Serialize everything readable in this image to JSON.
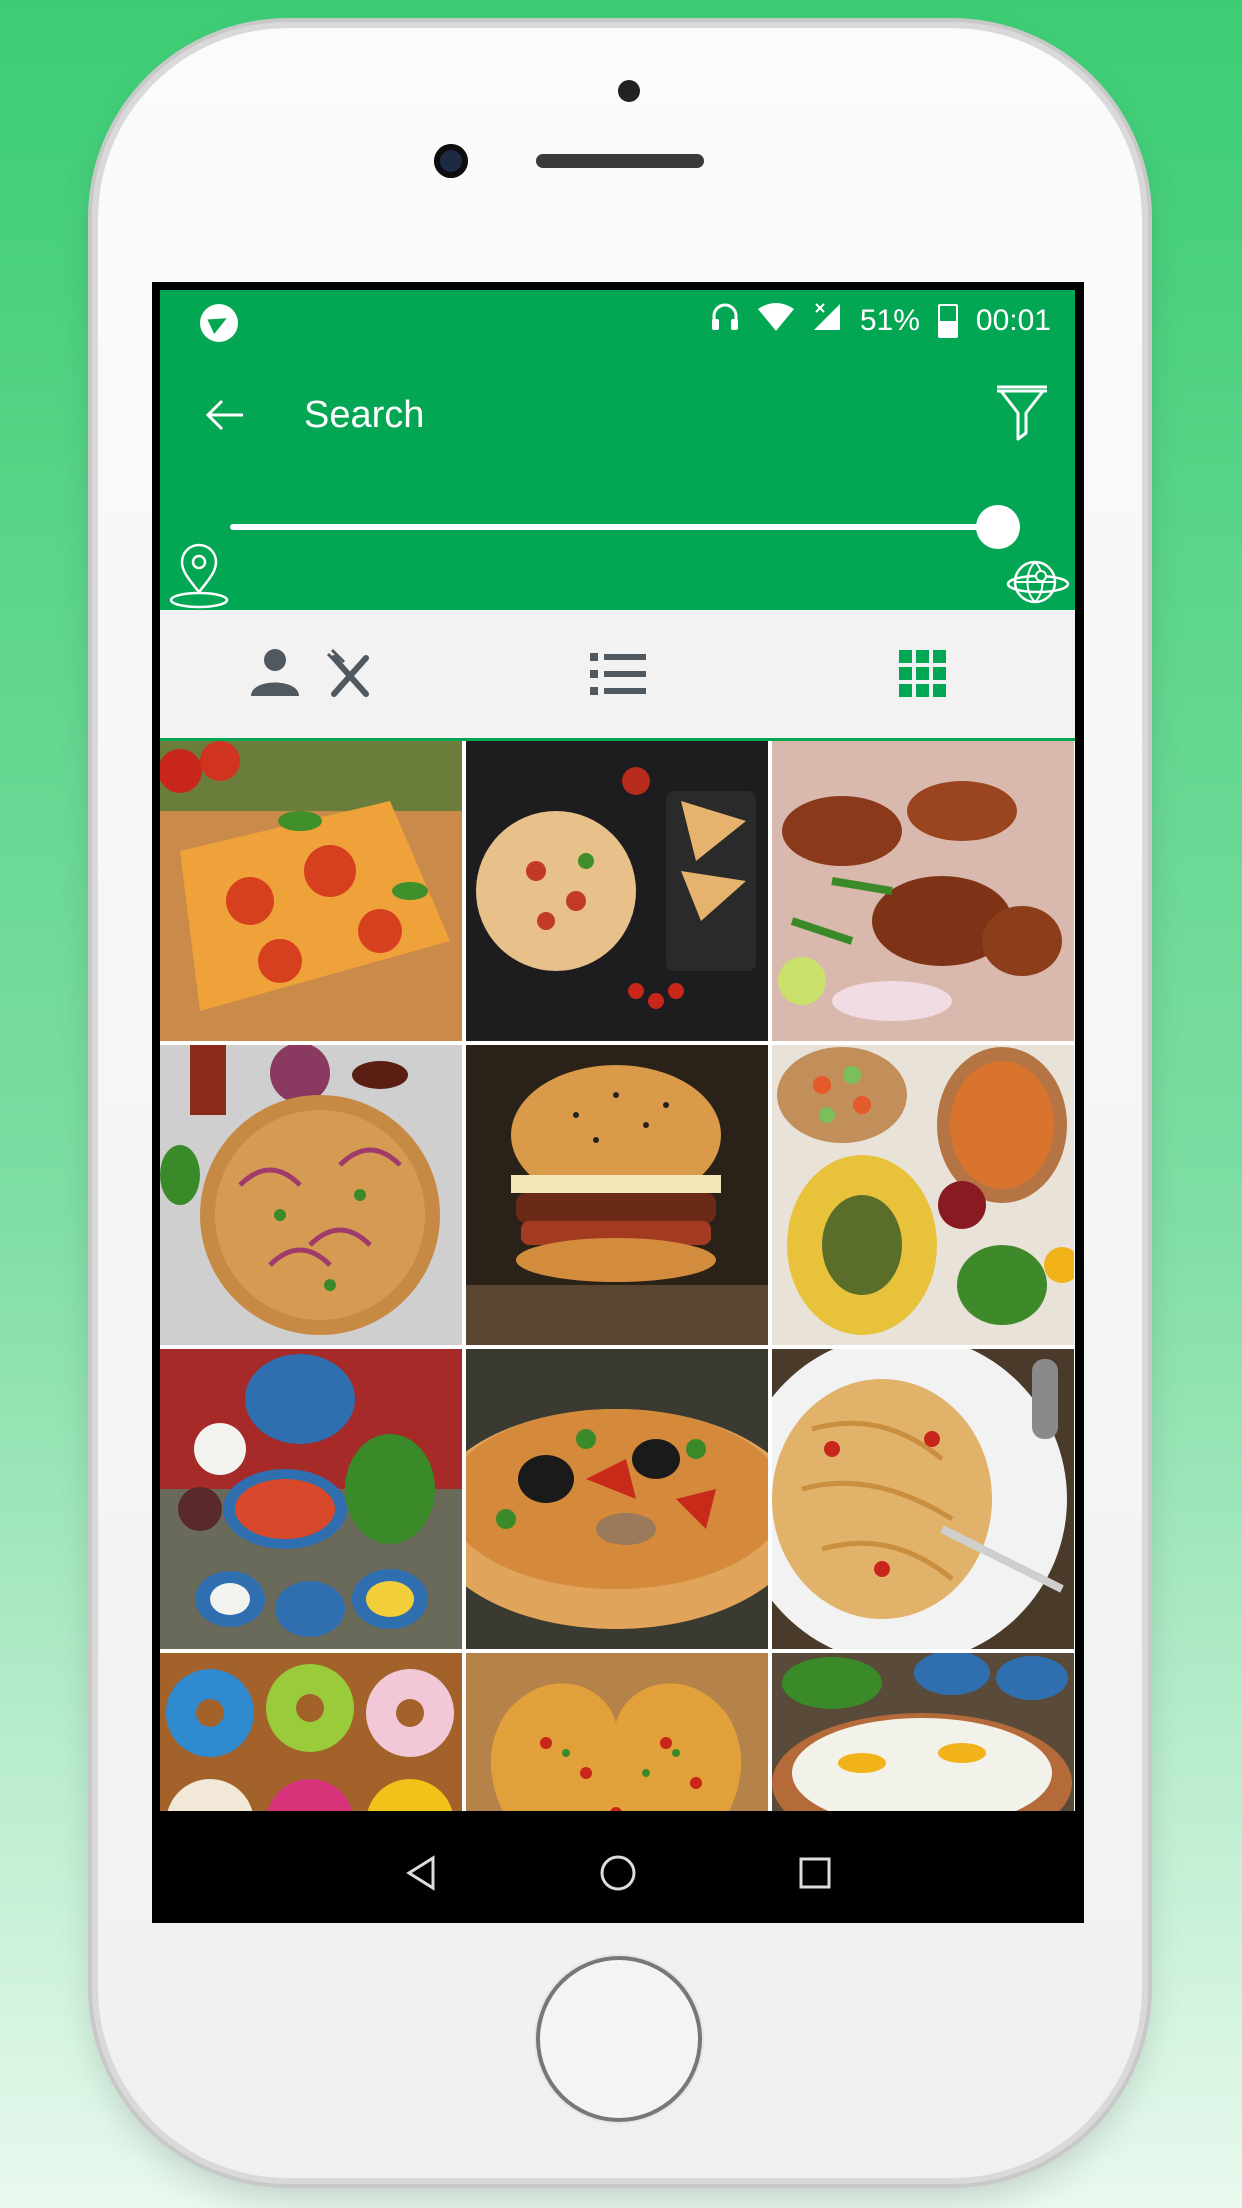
{
  "status_bar": {
    "battery": "51%",
    "time": "00:01"
  },
  "toolbar": {
    "title": "Search"
  },
  "distance_slider": {
    "value_fraction": 1.0
  },
  "view_tabs": [
    {
      "name": "people-and-restaurants",
      "selected": false
    },
    {
      "name": "list-view",
      "selected": false
    },
    {
      "name": "grid-view",
      "selected": true
    }
  ],
  "colors": {
    "accent": "#03a653",
    "tab_active": "#03a653",
    "tab_inactive": "#505860"
  },
  "grid_items": [
    {
      "icon": "pizza-photo"
    },
    {
      "icon": "pizza-slices-photo"
    },
    {
      "icon": "roast-chicken-photo"
    },
    {
      "icon": "pizza-onion-photo"
    },
    {
      "icon": "burger-photo"
    },
    {
      "icon": "persian-rice-platter-photo"
    },
    {
      "icon": "persian-dishes-photo"
    },
    {
      "icon": "olive-pizza-photo"
    },
    {
      "icon": "pasta-photo"
    },
    {
      "icon": "donuts-photo"
    },
    {
      "icon": "heart-pizza-photo"
    },
    {
      "icon": "rice-and-dishes-photo"
    }
  ]
}
